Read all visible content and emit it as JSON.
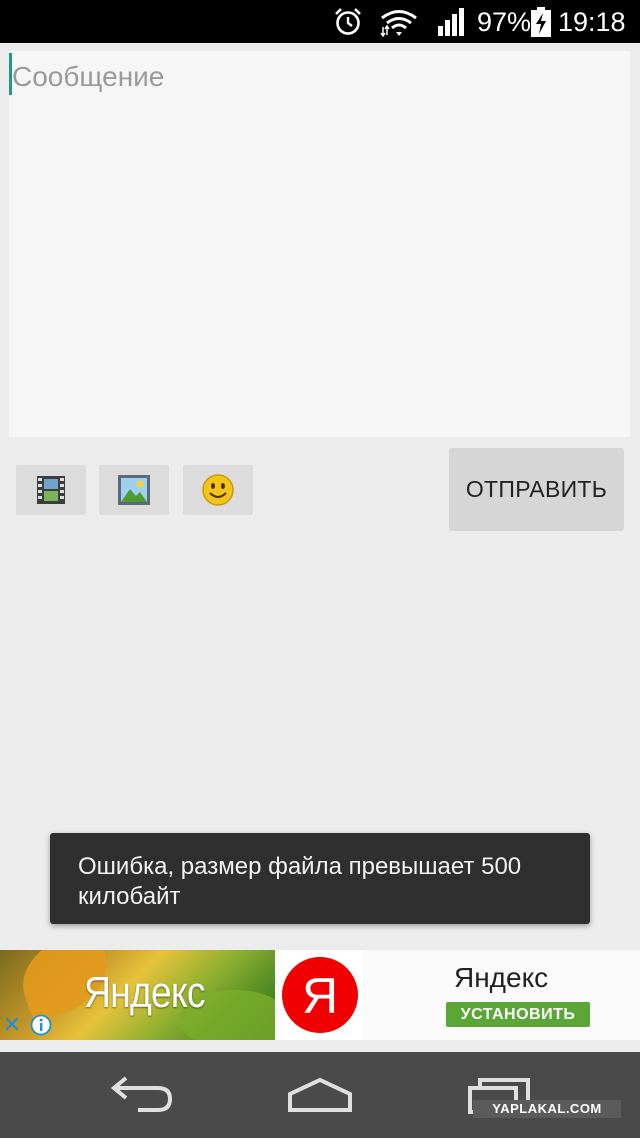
{
  "status_bar": {
    "battery_percent": "97%",
    "time": "19:18"
  },
  "compose": {
    "message_placeholder": "Сообщение",
    "send_label": "ОТПРАВИТЬ",
    "tools": [
      "video-icon",
      "image-icon",
      "smiley-icon"
    ]
  },
  "toast": {
    "text": "Ошибка, размер файла превышает 500 килобайт"
  },
  "ad": {
    "banner_text": "Яндекс",
    "title": "Яндекс",
    "install_label": "УСТАНОВИТЬ",
    "logo_letter": "Я",
    "logo_color": "#f00000",
    "install_color": "#5aa636"
  },
  "watermark": "YAPLAKAL.COM"
}
